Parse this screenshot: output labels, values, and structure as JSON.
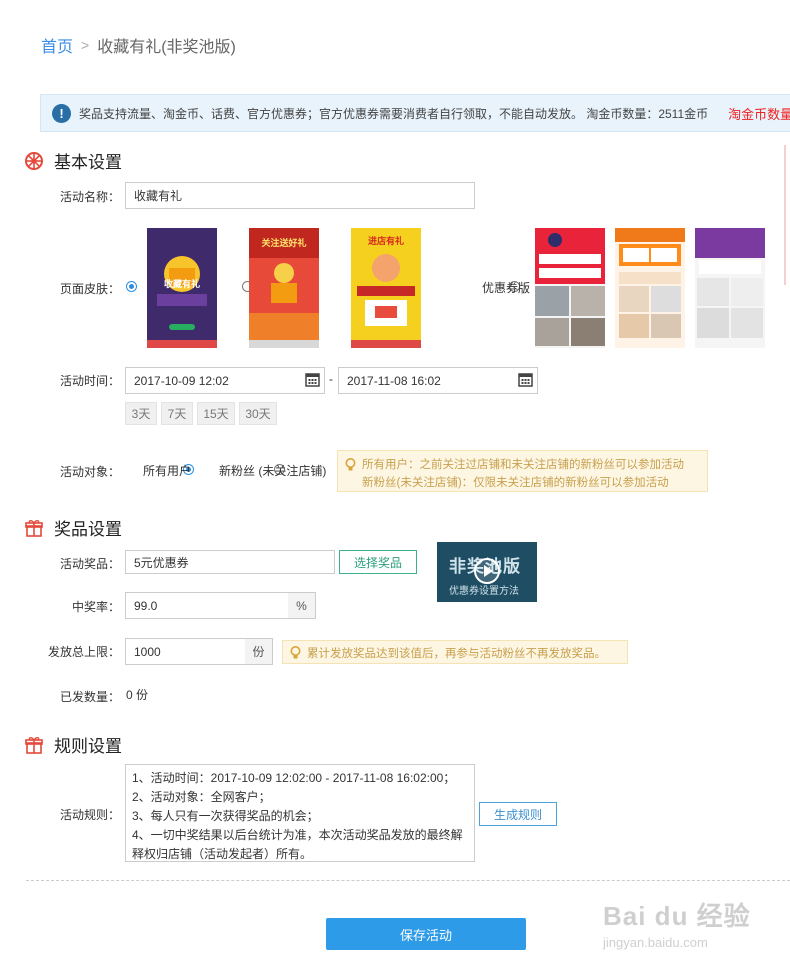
{
  "breadcrumb": {
    "home": "首页",
    "separator": ">",
    "current": "收藏有礼(非奖池版)"
  },
  "notice": {
    "text": "奖品支持流量、淘金币、话费、官方优惠券；官方优惠券需要消费者自行领取，不能自动发放。 淘金币数量：2511金币",
    "red_text": "淘金币数量"
  },
  "basic": {
    "title": "基本设置",
    "name_label": "活动名称：",
    "name_value": "收藏有礼",
    "skin_label": "页面皮肤：",
    "coupon_skin_label": "优惠券版",
    "skins": [
      {
        "title": "收藏有礼",
        "selected": true
      },
      {
        "title": "关注送好礼",
        "selected": false
      },
      {
        "title": "进店有礼",
        "selected": false
      }
    ],
    "time_label": "活动时间：",
    "start_time": "2017-10-09 12:02",
    "time_sep": "-",
    "end_time": "2017-11-08 16:02",
    "quick_days": [
      "3天",
      "7天",
      "15天",
      "30天"
    ],
    "target_label": "活动对象：",
    "target_all": "所有用户",
    "target_new": "新粉丝 (未关注店铺)",
    "target_tip_1": "所有用户：之前关注过店铺和未关注店铺的新粉丝可以参加活动",
    "target_tip_2": "新粉丝(未关注店铺)：仅限未关注店铺的新粉丝可以参加活动"
  },
  "prize": {
    "title": "奖品设置",
    "prize_label": "活动奖品：",
    "prize_value": "5元优惠券",
    "choose_button": "选择奖品",
    "rate_label": "中奖率：",
    "rate_value": "99.0",
    "rate_unit": "%",
    "limit_label": "发放总上限：",
    "limit_value": "1000",
    "limit_unit": "份",
    "limit_tip": "累计发放奖品达到该值后，再参与活动粉丝不再发放奖品。",
    "issued_label": "已发数量：",
    "issued_value": "0 份",
    "video_title": "非奖池版",
    "video_caption": "优惠券设置方法"
  },
  "rules": {
    "title": "规则设置",
    "rule_label": "活动规则：",
    "rule_lines": [
      "1、活动时间：2017-10-09 12:02:00 - 2017-11-08 16:02:00；",
      "2、活动对象：全网客户；",
      "3、每人只有一次获得奖品的机会；",
      "4、一切中奖结果以后台统计为准，本次活动奖品发放的最终解",
      "释权归店铺（活动发起者）所有。"
    ],
    "generate_button": "生成规则"
  },
  "save_button": "保存活动",
  "watermark": {
    "brand": "Bai du 经验",
    "url": "jingyan.baidu.com"
  }
}
